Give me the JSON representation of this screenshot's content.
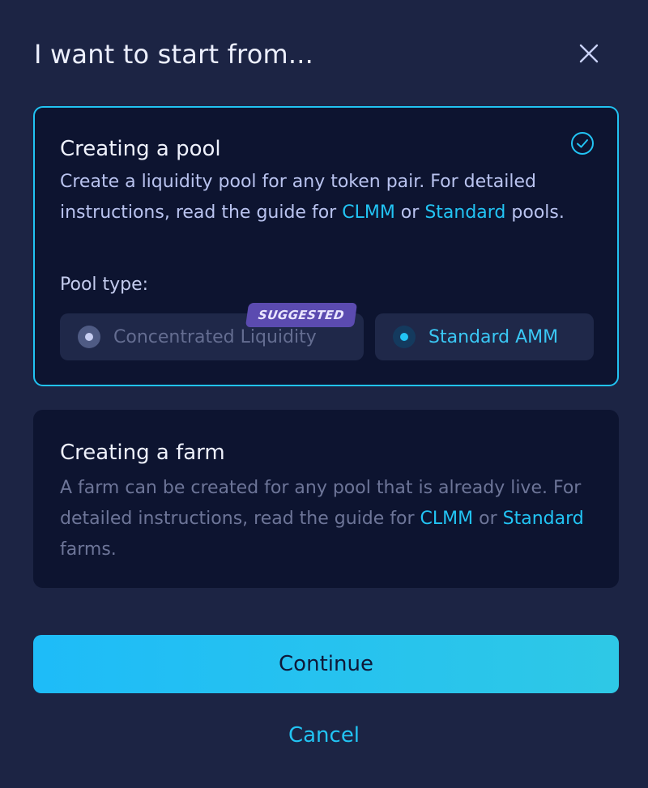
{
  "dialog": {
    "title": "I want to start from...",
    "close_icon": "close-icon"
  },
  "pool_card": {
    "title": "Creating a pool",
    "selected": true,
    "check_icon": "check-circle-icon",
    "desc_part1": "Create a liquidity pool for any token pair. For detailed instructions, read the guide for ",
    "link_clmm": "CLMM",
    "desc_or": " or ",
    "link_standard": "Standard",
    "desc_end": " pools.",
    "pool_type_label": "Pool type:",
    "options": [
      {
        "label": "Concentrated Liquidity",
        "selected": false,
        "badge": "SUGGESTED"
      },
      {
        "label": "Standard AMM",
        "selected": true
      }
    ]
  },
  "farm_card": {
    "title": "Creating a farm",
    "selected": false,
    "desc_part1": "A farm can be created for any pool that is already live. For detailed instructions, read the guide for ",
    "link_clmm": "CLMM",
    "desc_or": " or ",
    "link_standard": "Standard",
    "desc_end": " farms."
  },
  "actions": {
    "continue_label": "Continue",
    "cancel_label": "Cancel"
  },
  "colors": {
    "background": "#1c2444",
    "card": "#0d1430",
    "accent": "#22c4f4",
    "badge": "#5b4bb0"
  }
}
